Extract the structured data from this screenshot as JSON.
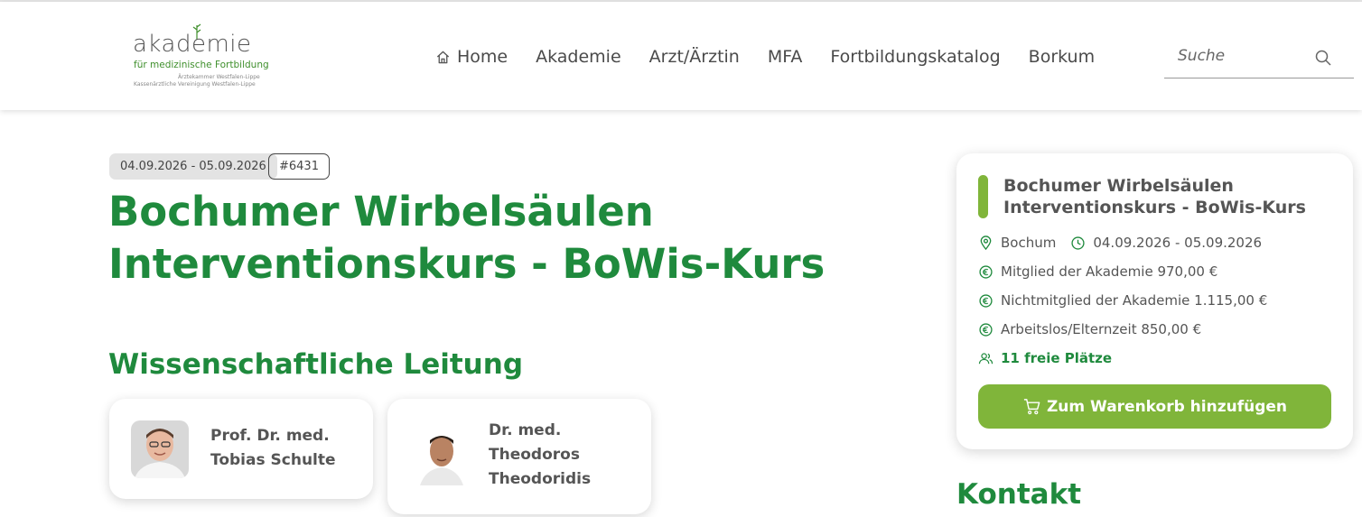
{
  "logo": {
    "main": "akademie",
    "sub": "für medizinische Fortbildung",
    "small1": "Ärztekammer Westfalen-Lippe",
    "small2": "Kassenärztliche Vereinigung Westfalen-Lippe"
  },
  "nav": {
    "items": [
      {
        "label": "Home",
        "icon": "home-icon"
      },
      {
        "label": "Akademie"
      },
      {
        "label": "Arzt/Ärztin"
      },
      {
        "label": "MFA"
      },
      {
        "label": "Fortbildungskatalog"
      },
      {
        "label": "Borkum"
      }
    ]
  },
  "search": {
    "placeholder": "Suche",
    "icon": "search-icon"
  },
  "course": {
    "date_range": "04.09.2026 - 05.09.2026",
    "id": "#6431",
    "title": "Bochumer Wirbelsäulen Interventionskurs - BoWis-Kurs"
  },
  "leitung": {
    "heading": "Wissenschaftliche Leitung",
    "persons": [
      {
        "name": "Prof. Dr. med. Tobias Schulte"
      },
      {
        "name": "Dr. med. Theodoros Theodoridis"
      }
    ]
  },
  "side_card": {
    "title": "Bochumer Wirbelsäulen Interventionskurs - BoWis-Kurs",
    "location": "Bochum",
    "dates": "04.09.2026 - 05.09.2026",
    "price_member": "Mitglied der Akademie 970,00 €",
    "price_nonmember": "Nichtmitglied der Akademie 1.115,00 €",
    "price_unemployed": "Arbeitslos/Elternzeit 850,00 €",
    "free_spots": "11 freie Plätze",
    "cart_button": "Zum Warenkorb hinzufügen"
  },
  "kontakt": {
    "heading": "Kontakt"
  },
  "colors": {
    "brand_green": "#1f8a3d",
    "accent_green": "#80b53a"
  }
}
